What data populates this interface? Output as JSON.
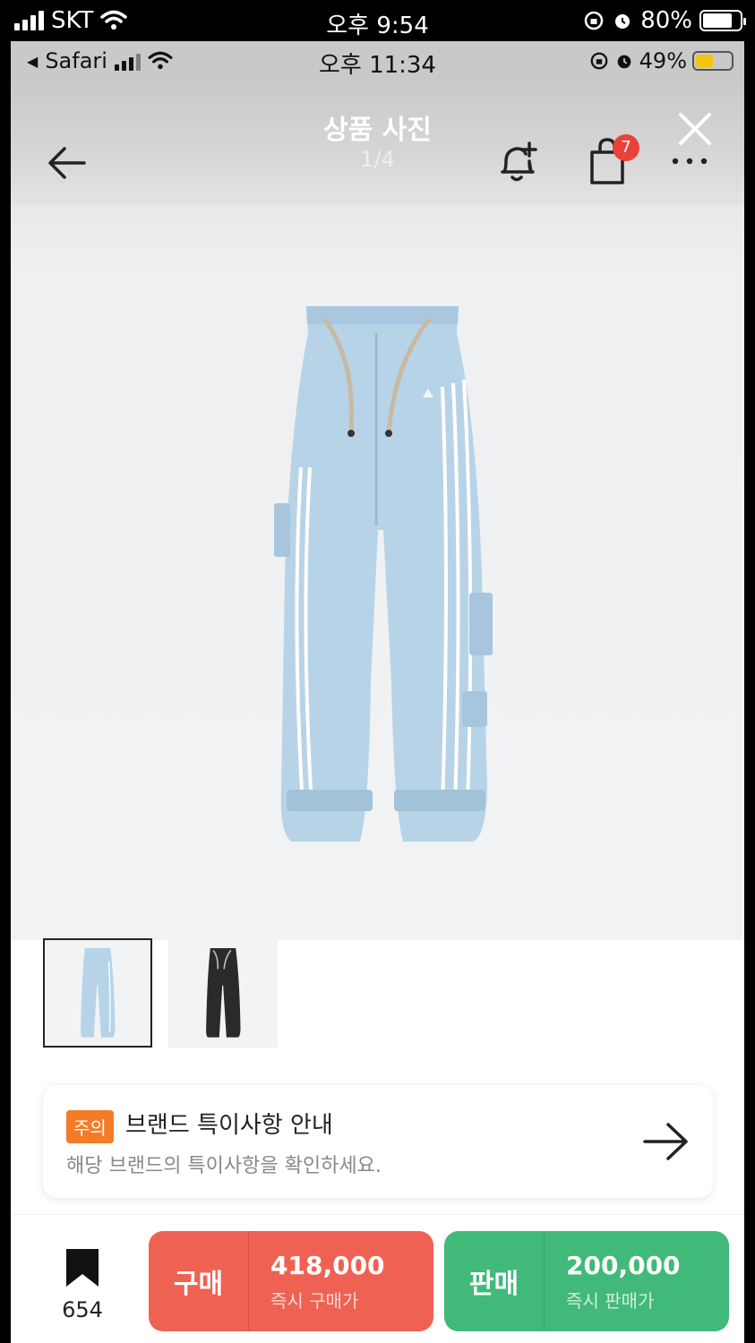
{
  "outer_status": {
    "carrier": "SKT",
    "time": "오후 9:54",
    "battery": "80%"
  },
  "inner_status": {
    "app": "Safari",
    "time": "오후 11:34",
    "battery": "49%"
  },
  "header": {
    "title": "상품 사진",
    "page_indicator": "1/4",
    "cart_count": "7"
  },
  "icons": [
    "back-arrow-icon",
    "alarm-add-icon",
    "shopping-bag-icon",
    "more-icon",
    "close-icon"
  ],
  "notice": {
    "tag": "주의",
    "title": "브랜드 특이사항 안내",
    "subtitle": "해당 브랜드의 특이사항을 확인하세요."
  },
  "bookmark": {
    "count": "654"
  },
  "buy": {
    "label": "구매",
    "price": "418,000",
    "sub": "즉시 구매가",
    "color": "#ef6253"
  },
  "sell": {
    "label": "판매",
    "price": "200,000",
    "sub": "즉시 판매가",
    "color": "#41b979"
  }
}
